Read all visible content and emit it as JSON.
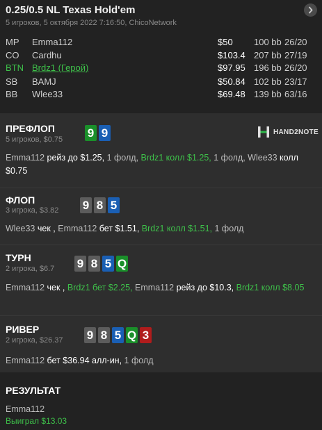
{
  "header": {
    "title": "0.25/0.5 NL Texas Hold'em",
    "subtitle": "5 игроков, 5 октября 2022 7:16:50, ChicoNetwork",
    "nav_icon": "chevron-right-icon"
  },
  "players": [
    {
      "pos": "MP",
      "name": "Emma112",
      "stack": "$50",
      "bb": "100 bb",
      "stats": "26/20",
      "hero": false
    },
    {
      "pos": "CO",
      "name": "Cardhu",
      "stack": "$103.4",
      "bb": "207 bb",
      "stats": "27/19",
      "hero": false
    },
    {
      "pos": "BTN",
      "name": "Brdz1 (Герой)",
      "stack": "$97.95",
      "bb": "196 bb",
      "stats": "26/20",
      "hero": true
    },
    {
      "pos": "SB",
      "name": "BAMJ",
      "stack": "$50.84",
      "bb": "102 bb",
      "stats": "23/17",
      "hero": false
    },
    {
      "pos": "BB",
      "name": "Wlee33",
      "stack": "$69.48",
      "bb": "139 bb",
      "stats": "63/16",
      "hero": false
    }
  ],
  "logo": {
    "text": "HAND2NOTE"
  },
  "preflop": {
    "title": "ПРЕФЛОП",
    "sub": "5 игроков, $0.75",
    "cards": [
      {
        "rank": "9",
        "color": "#1a8f2a"
      },
      {
        "rank": "9",
        "color": "#1a5fb4"
      }
    ],
    "actions": {
      "p1": "Emma112",
      "p1_action": "рейз до $1.25,",
      "p2": "1 фолд,",
      "p3": "Brdz1 колл $1.25,",
      "p4": "1 фолд,",
      "p5": "Wlee33",
      "p5_action": "колл",
      "p6": "$0.75"
    }
  },
  "flop": {
    "title": "ФЛОП",
    "sub": "3 игрока, $3.82",
    "cards": [
      {
        "rank": "9",
        "color": "#5c5c5c"
      },
      {
        "rank": "8",
        "color": "#5c5c5c"
      },
      {
        "rank": "5",
        "color": "#1a5fb4"
      }
    ],
    "actions": {
      "p1": "Wlee33",
      "p1_action": "чек ,",
      "p2": "Emma112",
      "p2_action": "бет $1.51,",
      "p3": "Brdz1 колл $1.51,",
      "p4": "1 фолд"
    }
  },
  "turn": {
    "title": "ТУРН",
    "sub": "2 игрока, $6.7",
    "cards": [
      {
        "rank": "9",
        "color": "#5c5c5c"
      },
      {
        "rank": "8",
        "color": "#5c5c5c"
      },
      {
        "rank": "5",
        "color": "#1a5fb4"
      },
      {
        "rank": "Q",
        "color": "#1a8f2a"
      }
    ],
    "actions": {
      "p1": "Emma112",
      "p1_action": "чек ,",
      "p2": "Brdz1 бет $2.25,",
      "p3": "Emma112",
      "p3_action": "рейз до $10.3,",
      "p4": "Brdz1 колл",
      "p5": "$8.05"
    }
  },
  "river": {
    "title": "РИВЕР",
    "sub": "2 игрока, $26.37",
    "cards": [
      {
        "rank": "9",
        "color": "#5c5c5c"
      },
      {
        "rank": "8",
        "color": "#5c5c5c"
      },
      {
        "rank": "5",
        "color": "#1a5fb4"
      },
      {
        "rank": "Q",
        "color": "#1a8f2a"
      },
      {
        "rank": "3",
        "color": "#b01c1c"
      }
    ],
    "actions": {
      "p1": "Emma112",
      "p1_action": "бет $36.94 алл-ин,",
      "p2": "1 фолд"
    }
  },
  "result": {
    "title": "РЕЗУЛЬТАТ",
    "winner": "Emma112",
    "won": "Выиграл $13.03"
  }
}
